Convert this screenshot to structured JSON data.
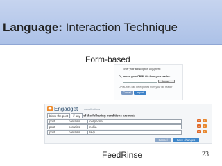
{
  "slide": {
    "title_bold": "Language:",
    "title_rest": " Interaction Technique",
    "caption_top": "Form-based",
    "caption_bottom": "FeedRinse",
    "number": "23"
  },
  "form_screenshot": {
    "line1": "Enter your subscription url(s) here:",
    "line2": "Or, import your OPML file from your reader:",
    "browse_label": "Browse...",
    "line3": "OPML files can be exported from your rss reader",
    "cancel_label": "Cancel",
    "import_label": "Import"
  },
  "filter_screenshot": {
    "feed_icon": "rss-icon",
    "feed_title": "Engadget",
    "feed_subtitle": "no collections",
    "head_prefix": "block the post",
    "head_select": "if any",
    "head_suffix": "of the following conditions are met:",
    "rules": [
      {
        "field": "post",
        "operator": "contains",
        "value": "cellphone"
      },
      {
        "field": "post",
        "operator": "contains",
        "value": "nokia"
      },
      {
        "field": "post",
        "operator": "contains",
        "value": "lavy"
      }
    ],
    "minus_glyph": "−",
    "plus_glyph": "+",
    "cancel_label": "Cancel",
    "save_label": "Save changes"
  }
}
